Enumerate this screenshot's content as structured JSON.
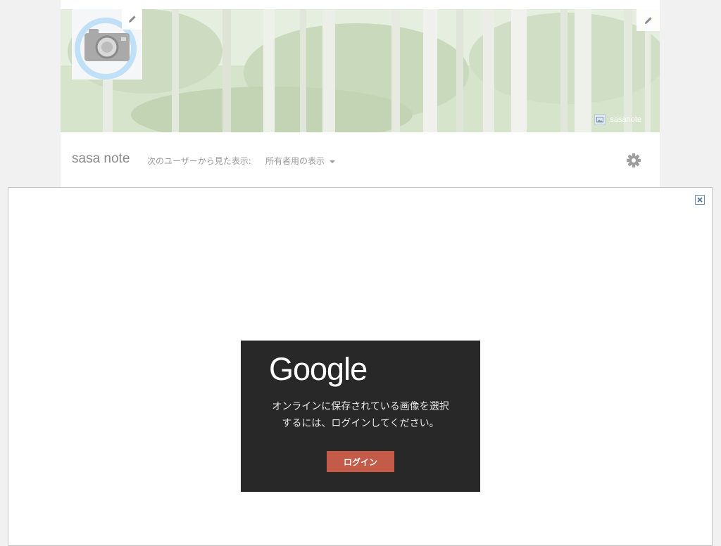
{
  "cover": {
    "credit_name": "sasanote"
  },
  "page": {
    "title": "sasa note",
    "view_as_label": "次のユーザーから見た表示:",
    "view_as_value": "所有者用の表示"
  },
  "icons": {
    "cover_edit": "pencil-icon",
    "profile_edit": "pencil-icon",
    "profile_placeholder": "camera-icon",
    "settings": "gear-icon",
    "close": "close-icon"
  },
  "signin_dialog": {
    "logo_text": "Google",
    "message_line1": "オンラインに保存されている画像を選択",
    "message_line2": "するには、ログインしてください。",
    "login_button": "ログイン"
  },
  "colors": {
    "login_button": "#c45a48",
    "signin_background": "#282828",
    "close_border": "#6f8fb5"
  }
}
